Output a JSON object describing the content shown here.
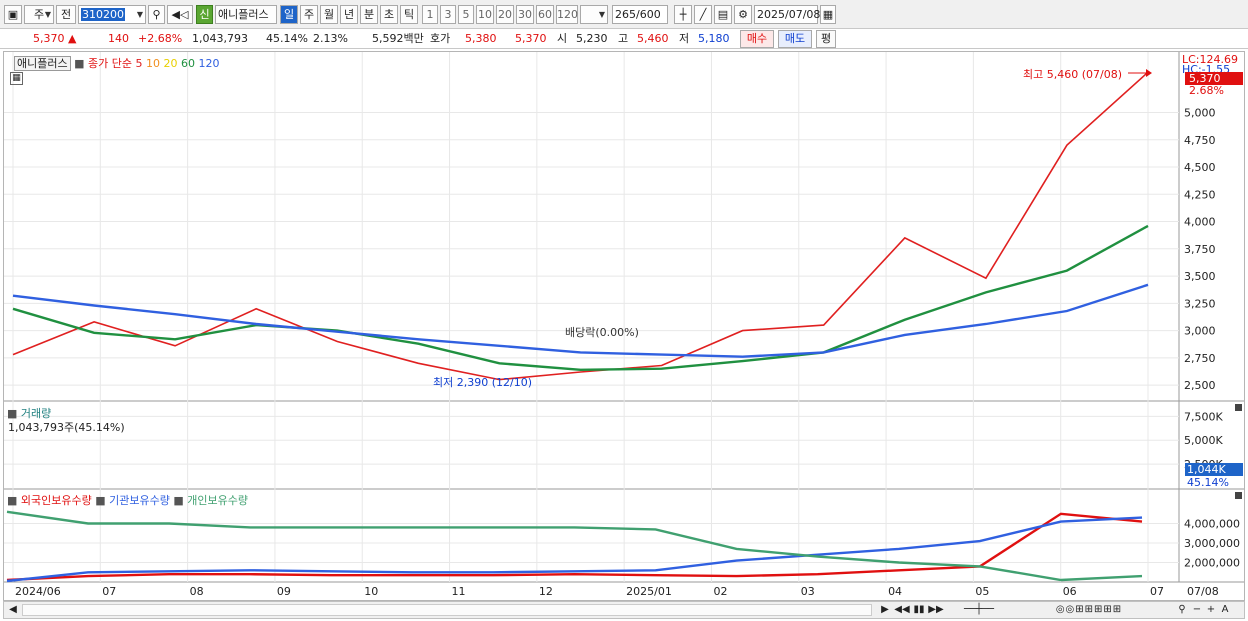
{
  "toolbar": {
    "market_type": "주",
    "prev_label": "전",
    "code": "310200",
    "credit_badge": "신",
    "stock_name": "애니플러스",
    "periods": [
      "일",
      "주",
      "월",
      "년",
      "분",
      "초",
      "틱"
    ],
    "active_period": "일",
    "intervals": [
      "1",
      "3",
      "5",
      "10",
      "20",
      "30",
      "60",
      "120"
    ],
    "count": "265",
    "count_max": "/600",
    "date": "2025/07/08"
  },
  "quote": {
    "price": "5,370",
    "arrow": "▲",
    "change": "140",
    "change_rate": "+2.68%",
    "volume": "1,043,793",
    "volume_rate": "45.14%",
    "turnover_rate": "2.13%",
    "trade_value": "5,592백만",
    "ask_label": "호가",
    "ask": "5,380",
    "bid": "5,370",
    "open_label": "시",
    "open": "5,230",
    "high_label": "고",
    "high": "5,460",
    "low_label": "저",
    "low": "5,180",
    "buy_label": "매수",
    "sell_label": "매도",
    "alt_label": "평"
  },
  "price_pane": {
    "stock_label": "애니플러스",
    "ma_label": "종가 단순",
    "ma_periods": [
      "5",
      "10",
      "20",
      "60",
      "120"
    ],
    "lc_label": "LC:124.69",
    "hc_label": "HC:-1.55",
    "current_price_tag": "5,370",
    "current_change_tag": "2.68%",
    "high_annotation": "최고 5,460 (07/08)",
    "low_annotation": "최저 2,390 (12/10)",
    "dividend_annotation": "배당락(0.00%)",
    "y_ticks": [
      "5,000",
      "4,750",
      "4,500",
      "4,250",
      "4,000",
      "3,750",
      "3,500",
      "3,250",
      "3,000",
      "2,750",
      "2,500"
    ]
  },
  "volume_pane": {
    "title": "거래량",
    "value": "1,043,793주(45.14%)",
    "y_ticks": [
      "7,500K",
      "5,000K",
      "2,500K"
    ],
    "current_tag": "1,044K",
    "current_rate_tag": "45.14%"
  },
  "holding_pane": {
    "series": [
      "외국인보유수량",
      "기관보유수량",
      "개인보유수량"
    ],
    "y_ticks": [
      "4,000,000",
      "3,000,000",
      "2,000,000"
    ]
  },
  "x_axis": {
    "labels": [
      "2024/06",
      "07",
      "08",
      "09",
      "10",
      "11",
      "12",
      "2025/01",
      "02",
      "03",
      "04",
      "05",
      "06",
      "07"
    ],
    "end_label": "07/08"
  },
  "colors": {
    "up": "#e01010",
    "down": "#1040d0",
    "ma5": "#e02020",
    "ma10": "#f09020",
    "ma20": "#f0e020",
    "ma60": "#209040",
    "ma120": "#3060e0",
    "foreign": "#e01010",
    "institution": "#3060e0",
    "individual": "#40a070"
  },
  "chart_data": {
    "type": "line",
    "title": "애니플러스",
    "x": [
      "2024/06",
      "07",
      "08",
      "09",
      "10",
      "11",
      "12",
      "2025/01",
      "02",
      "03",
      "04",
      "05",
      "06",
      "07"
    ],
    "ylim": [
      2400,
      5500
    ],
    "series": [
      {
        "name": "종가",
        "values": [
          2780,
          3080,
          2860,
          3200,
          2900,
          2700,
          2550,
          2620,
          2680,
          3000,
          3050,
          3850,
          3480,
          4700,
          5370
        ]
      },
      {
        "name": "60",
        "values": [
          3200,
          2980,
          2920,
          3050,
          3000,
          2880,
          2700,
          2640,
          2650,
          2720,
          2800,
          3100,
          3350,
          3550,
          3960
        ]
      },
      {
        "name": "120",
        "values": [
          3320,
          3230,
          3150,
          3060,
          2990,
          2920,
          2860,
          2800,
          2780,
          2760,
          2800,
          2960,
          3060,
          3180,
          3420
        ]
      }
    ],
    "volume_ylim": [
      0,
      9000
    ],
    "holdings": {
      "ylim": [
        1000000,
        5000000
      ],
      "series": [
        {
          "name": "외국인보유수량",
          "values": [
            1100000,
            1300000,
            1400000,
            1400000,
            1350000,
            1350000,
            1350000,
            1400000,
            1350000,
            1300000,
            1400000,
            1600000,
            1800000,
            4500000,
            4100000
          ]
        },
        {
          "name": "기관보유수량",
          "values": [
            1050000,
            1500000,
            1550000,
            1600000,
            1550000,
            1500000,
            1500000,
            1550000,
            1600000,
            2100000,
            2400000,
            2700000,
            3100000,
            4100000,
            4300000
          ]
        },
        {
          "name": "개인보유수량",
          "values": [
            4600000,
            4000000,
            4000000,
            3800000,
            3800000,
            3800000,
            3800000,
            3800000,
            3700000,
            2700000,
            2300000,
            2000000,
            1800000,
            1100000,
            1300000
          ]
        }
      ]
    }
  }
}
